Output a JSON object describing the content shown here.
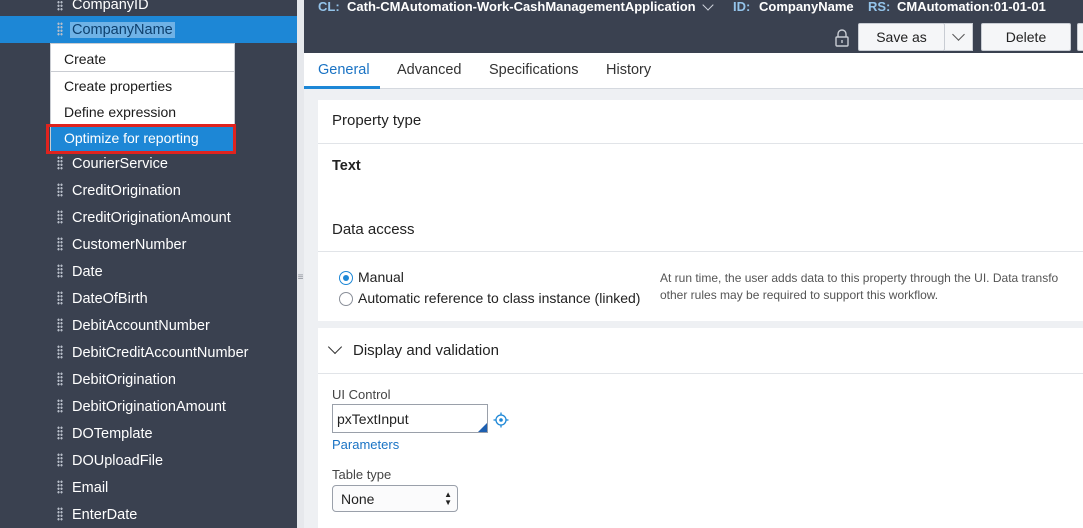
{
  "sidebar": {
    "items": [
      {
        "label": "CompanyID"
      },
      {
        "label": "CompanyName"
      },
      {
        "label": ""
      },
      {
        "label": ""
      },
      {
        "label": ""
      },
      {
        "label": ""
      },
      {
        "label": "CourierService"
      },
      {
        "label": "CreditOrigination"
      },
      {
        "label": "CreditOriginationAmount"
      },
      {
        "label": "CustomerNumber"
      },
      {
        "label": "Date"
      },
      {
        "label": "DateOfBirth"
      },
      {
        "label": "DebitAccountNumber"
      },
      {
        "label": "DebitCreditAccountNumber"
      },
      {
        "label": "DebitOrigination"
      },
      {
        "label": "DebitOriginationAmount"
      },
      {
        "label": "DOTemplate"
      },
      {
        "label": "DOUploadFile"
      },
      {
        "label": "Email"
      },
      {
        "label": "EnterDate"
      }
    ]
  },
  "context_menu": {
    "items": [
      {
        "label": "Create"
      },
      {
        "label": "Create properties"
      },
      {
        "label": "Define expression"
      },
      {
        "label": "Optimize for reporting"
      }
    ]
  },
  "header": {
    "cl_key": "CL:",
    "cl_value": "Cath-CMAutomation-Work-CashManagementApplication",
    "id_key": "ID:",
    "id_value": "CompanyName",
    "rs_key": "RS:",
    "rs_value": "CMAutomation:01-01-01",
    "save_as_label": "Save as",
    "delete_label": "Delete"
  },
  "tabs": [
    {
      "label": "General"
    },
    {
      "label": "Advanced"
    },
    {
      "label": "Specifications"
    },
    {
      "label": "History"
    }
  ],
  "property_type": {
    "title": "Property type",
    "value": "Text"
  },
  "data_access": {
    "title": "Data access",
    "options": [
      {
        "label": "Manual",
        "checked": true
      },
      {
        "label": "Automatic reference to class instance (linked)",
        "checked": false
      }
    ],
    "help_line1": "At run time, the user adds data to this property through the UI. Data transfo",
    "help_line2": "other rules may be required to support this workflow."
  },
  "display_validation": {
    "title": "Display and validation",
    "ui_control_label": "UI Control",
    "ui_control_value": "pxTextInput",
    "parameters_link": "Parameters",
    "table_type_label": "Table type",
    "table_type_value": "None"
  },
  "colors": {
    "accent": "#1d87d6",
    "sidebar_bg": "#3a4150",
    "highlight_outline": "#e0231e"
  }
}
